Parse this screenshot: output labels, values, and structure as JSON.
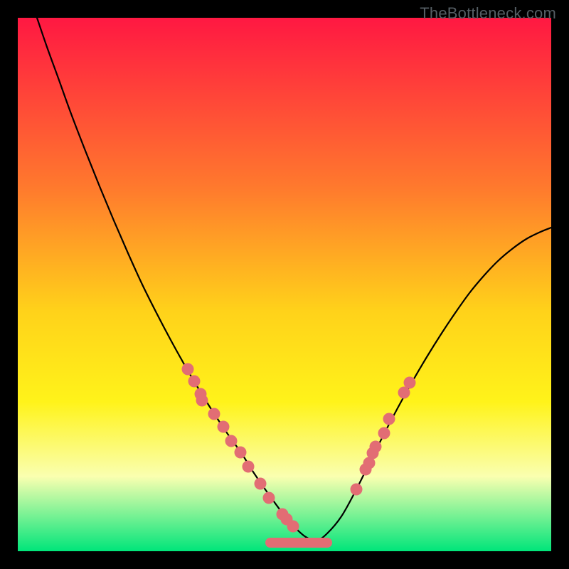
{
  "watermark": "TheBottleneck.com",
  "colors": {
    "gradient_top": "#ff1842",
    "gradient_mid1": "#ff7a2d",
    "gradient_mid2": "#ffd21a",
    "gradient_mid3": "#fff31a",
    "gradient_mid4": "#faffb0",
    "gradient_bottom": "#00e57a",
    "curve_stroke": "#000000",
    "dot_fill": "#e26d74",
    "frame": "#000000"
  },
  "chart_data": {
    "type": "line",
    "title": "",
    "xlabel": "",
    "ylabel": "",
    "xlim": [
      25,
      775
    ],
    "ylim": [
      25,
      775
    ],
    "grid": false,
    "legend": false,
    "series": [
      {
        "name": "bottleneck-curve",
        "x": [
          52,
          66,
          82,
          100,
          120,
          140,
          160,
          180,
          200,
          220,
          240,
          260,
          280,
          300,
          320,
          340,
          355,
          370,
          385,
          400,
          415,
          430,
          445,
          460,
          480,
          500,
          520,
          540,
          560,
          580,
          600,
          620,
          640,
          660,
          680,
          700,
          720,
          740,
          760,
          775
        ],
        "y": [
          25,
          66,
          110,
          160,
          212,
          262,
          310,
          356,
          400,
          440,
          478,
          514,
          548,
          580,
          610,
          638,
          662,
          684,
          705,
          725,
          742,
          755,
          760,
          750,
          726,
          690,
          650,
          610,
          572,
          536,
          502,
          470,
          440,
          412,
          388,
          367,
          350,
          336,
          326,
          320
        ]
      }
    ],
    "dots": [
      {
        "x": 264,
        "y": 519
      },
      {
        "x": 273,
        "y": 536
      },
      {
        "x": 282,
        "y": 554
      },
      {
        "x": 284,
        "y": 563
      },
      {
        "x": 301,
        "y": 582
      },
      {
        "x": 314,
        "y": 600
      },
      {
        "x": 325,
        "y": 620
      },
      {
        "x": 338,
        "y": 636
      },
      {
        "x": 349,
        "y": 656
      },
      {
        "x": 366,
        "y": 680
      },
      {
        "x": 378,
        "y": 700
      },
      {
        "x": 397,
        "y": 723
      },
      {
        "x": 403,
        "y": 730
      },
      {
        "x": 412,
        "y": 740
      },
      {
        "x": 501,
        "y": 688
      },
      {
        "x": 514,
        "y": 660
      },
      {
        "x": 519,
        "y": 651
      },
      {
        "x": 524,
        "y": 637
      },
      {
        "x": 528,
        "y": 628
      },
      {
        "x": 540,
        "y": 609
      },
      {
        "x": 547,
        "y": 589
      },
      {
        "x": 568,
        "y": 552
      },
      {
        "x": 576,
        "y": 538
      }
    ],
    "flat_segment": {
      "x_start": 380,
      "x_end": 460,
      "y": 763
    }
  }
}
